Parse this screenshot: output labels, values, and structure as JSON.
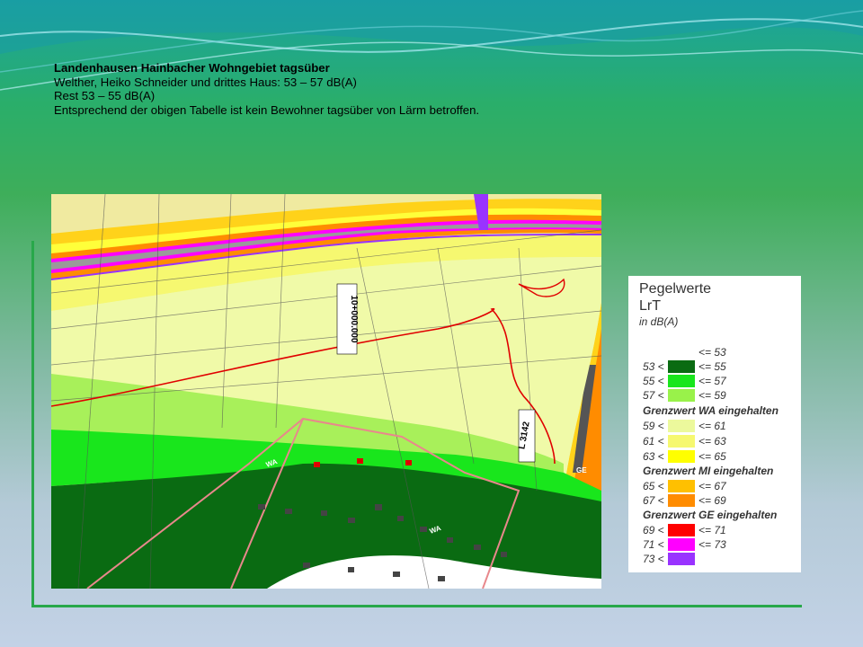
{
  "slide": {
    "title": "Landenhausen Hainbacher Wohngebiet tagsüber",
    "lines": [
      "Welther, Heiko Schneider und drittes Haus:  53 – 57 dB(A)",
      "Rest 53 – 55 dB(A)",
      "Entsprechend der obigen Tabelle ist kein Bewohner tagsüber von Lärm betroffen."
    ]
  },
  "map": {
    "station_label": "10+000.000",
    "road_label": "L 3142",
    "zone_labels": [
      "WA",
      "WA",
      "GE"
    ]
  },
  "legend": {
    "title": "Pegelwerte",
    "subtitle": "LrT",
    "unit": "in dB(A)",
    "rows": [
      {
        "lo": "",
        "hi": "<= 53",
        "color": "#ffffff"
      },
      {
        "lo": "53 <",
        "hi": "<= 55",
        "color": "#0a6b12"
      },
      {
        "lo": "55 <",
        "hi": "<= 57",
        "color": "#19e61c"
      },
      {
        "lo": "57 <",
        "hi": "<= 59",
        "color": "#99f24a"
      },
      {
        "lo": "59 <",
        "hi": "<= 61",
        "color": "#ecf99c"
      },
      {
        "lo": "61 <",
        "hi": "<= 63",
        "color": "#f6f870"
      },
      {
        "lo": "63 <",
        "hi": "<= 65",
        "color": "#ffff00"
      },
      {
        "lo": "65 <",
        "hi": "<= 67",
        "color": "#ffc000"
      },
      {
        "lo": "67 <",
        "hi": "<= 69",
        "color": "#ff8c00"
      },
      {
        "lo": "69 <",
        "hi": "<= 71",
        "color": "#ff0000"
      },
      {
        "lo": "71 <",
        "hi": "<= 73",
        "color": "#ff00ff"
      },
      {
        "lo": "73 <",
        "hi": "",
        "color": "#9933ff"
      }
    ],
    "notes": [
      "Grenzwert WA eingehalten",
      "Grenzwert MI eingehalten",
      "Grenzwert GE eingehalten"
    ]
  }
}
